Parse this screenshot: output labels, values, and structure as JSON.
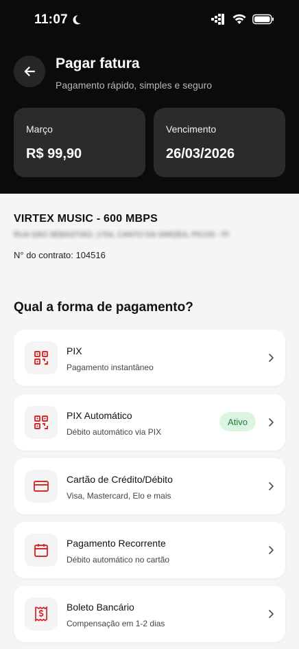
{
  "status_bar": {
    "time": "11:07"
  },
  "header": {
    "title": "Pagar fatura",
    "subtitle": "Pagamento rápido, simples e seguro"
  },
  "summary": {
    "month_label": "Março",
    "amount": "R$ 99,90",
    "due_label": "Vencimento",
    "due_date": "26/03/2026"
  },
  "contract": {
    "plan": "VIRTEX MUSIC - 600 MBPS",
    "address": "RUA SÃO SEBASTIÃO, 1704, CANTO DA VARZEA, PICOS - PI",
    "contract_label": "N° do contrato: 104516"
  },
  "payment": {
    "section_title": "Qual a forma de pagamento?",
    "methods": [
      {
        "title": "PIX",
        "description": "Pagamento instantâneo",
        "icon": "qr-code-icon"
      },
      {
        "title": "PIX Automático",
        "description": "Débito automático via PIX",
        "icon": "qr-code-icon",
        "badge": "Ativo"
      },
      {
        "title": "Cartão de Crédito/Débito",
        "description": "Visa, Mastercard, Elo e mais",
        "icon": "credit-card-icon"
      },
      {
        "title": "Pagamento Recorrente",
        "description": "Débito automático no cartão",
        "icon": "calendar-icon"
      },
      {
        "title": "Boleto Bancário",
        "description": "Compensação em 1-2 dias",
        "icon": "boleto-icon"
      }
    ]
  },
  "colors": {
    "header_bg": "#0b0b0b",
    "card_dark": "#2b2b2b",
    "accent_red": "#d42a2a",
    "badge_bg": "#dcf5e2",
    "badge_text": "#1f7a36",
    "page_bg": "#f5f5f5"
  }
}
